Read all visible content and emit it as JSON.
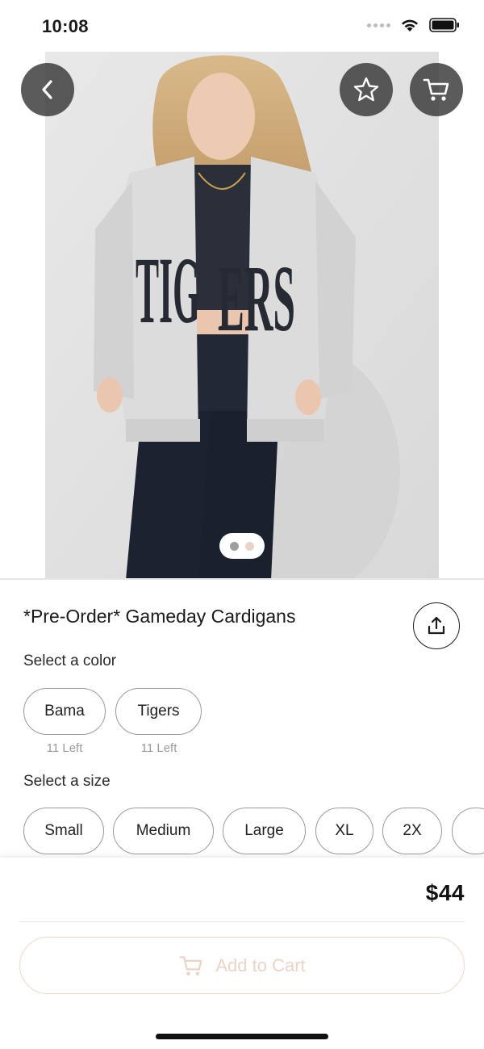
{
  "status_bar": {
    "time": "10:08",
    "icons": [
      "signal-dots-icon",
      "wifi-icon",
      "battery-icon"
    ]
  },
  "hero": {
    "image_alt": "Model wearing a grey TIGERS cardigan",
    "image_print_text": "TIGERS",
    "pager": {
      "count": 2,
      "active_index": 0,
      "active_color": "#9e9e9e",
      "inactive_color": "#e9d3c6"
    }
  },
  "nav": {
    "back_icon": "chevron-left-icon",
    "favorite_icon": "star-icon",
    "cart_icon": "cart-icon"
  },
  "product": {
    "title": "*Pre-Order* Gameday Cardigans",
    "share_icon": "share-icon",
    "color_label": "Select a color",
    "colors": [
      {
        "label": "Bama",
        "stock": "11 Left"
      },
      {
        "label": "Tigers",
        "stock": "11 Left"
      }
    ],
    "size_label": "Select a size",
    "sizes": [
      "Small",
      "Medium",
      "Large",
      "XL",
      "2X"
    ]
  },
  "footer": {
    "price": "$44",
    "add_to_cart_label": "Add to Cart",
    "accent_color": "#ecd3c5"
  }
}
